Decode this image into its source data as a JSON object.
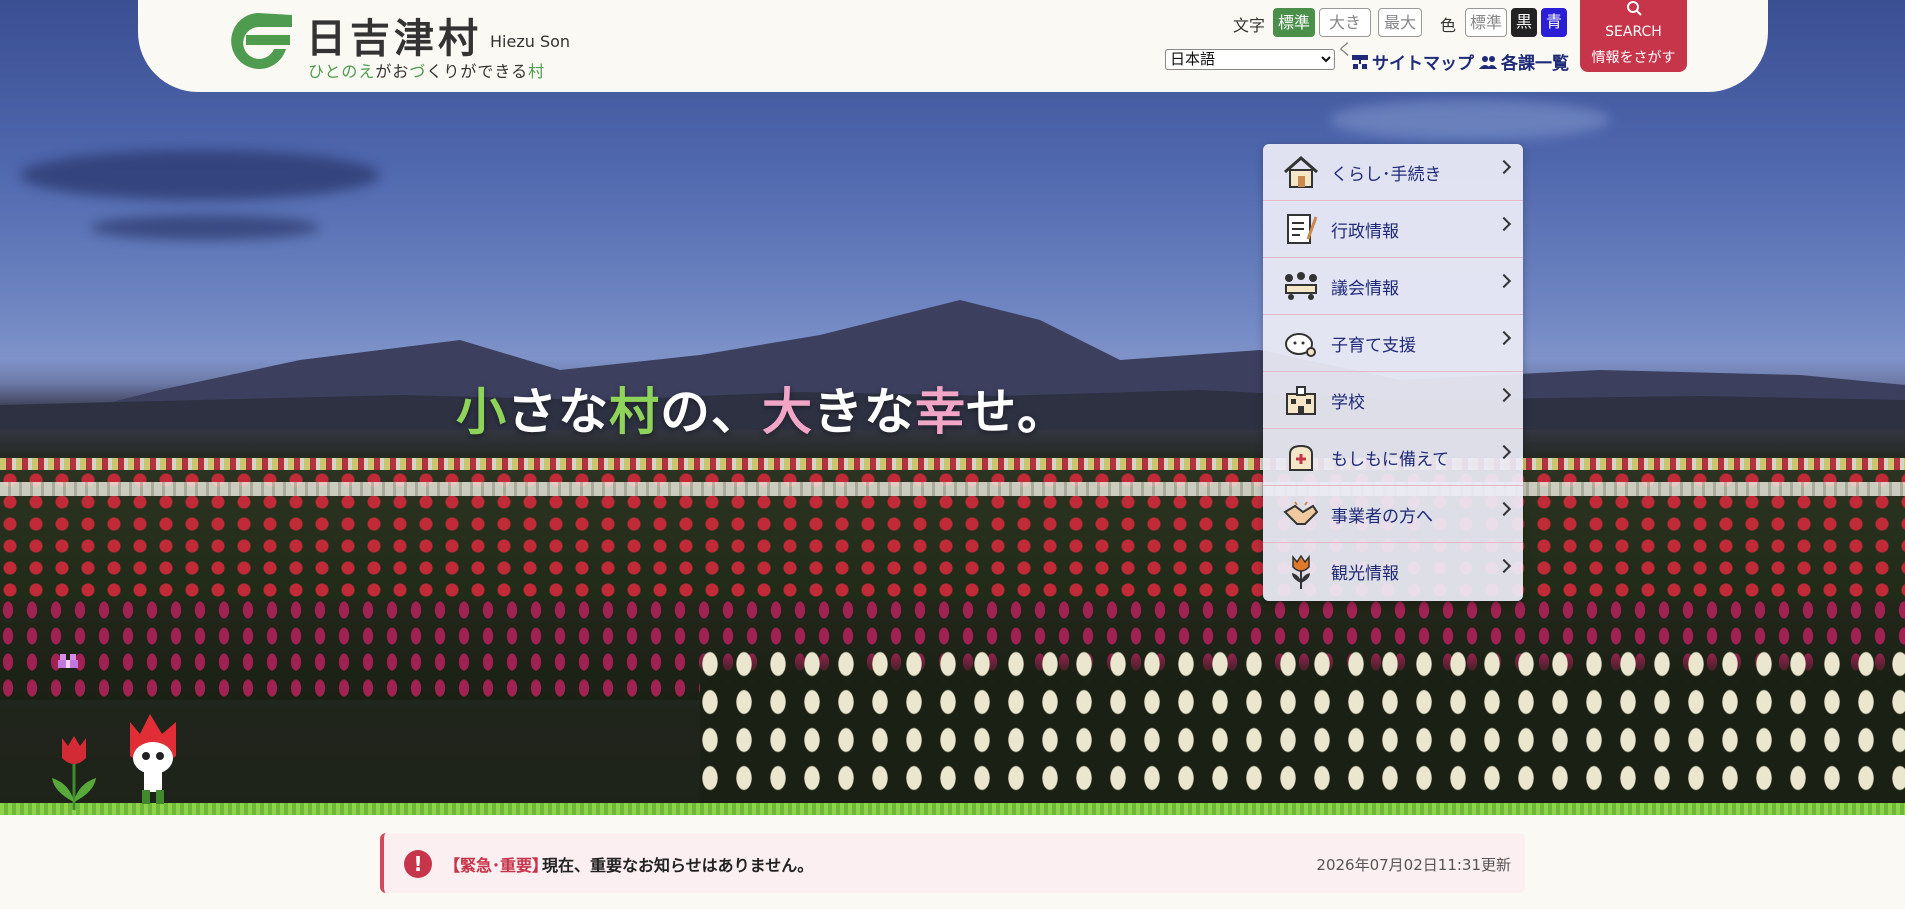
{
  "header": {
    "logo_name": "日吉津村",
    "logo_roman": "Hiezu Son",
    "logo_tagline": [
      "ひとの",
      "え",
      "がお",
      "づ",
      "くりができる",
      "村"
    ],
    "text_size": {
      "label": "文字",
      "options": [
        "標準",
        "大きく",
        "最大"
      ],
      "active": "標準"
    },
    "color": {
      "label": "色",
      "options": [
        "標準",
        "黒",
        "青"
      ]
    },
    "language_select": {
      "value": "日本語"
    },
    "sitemap_label": "サイトマップ",
    "departments_label": "各課一覧",
    "search": {
      "line1": "SEARCH",
      "line2": "情報をさがす"
    },
    "colors": {
      "accent_green": "#4a8f4a",
      "accent_red": "#c7354a",
      "link_navy": "#1f2a78"
    }
  },
  "hero": {
    "catchphrase": [
      "小",
      "さな",
      "村",
      "の、",
      "大",
      "きな",
      "幸",
      "せ。"
    ]
  },
  "menu": {
    "items": [
      {
        "label": "くらし･手続き",
        "icon": "house-icon"
      },
      {
        "label": "行政情報",
        "icon": "document-pen-icon"
      },
      {
        "label": "議会情報",
        "icon": "council-meeting-icon"
      },
      {
        "label": "子育て支援",
        "icon": "baby-icon"
      },
      {
        "label": "学校",
        "icon": "school-icon"
      },
      {
        "label": "もしもに備えて",
        "icon": "emergency-bag-icon"
      },
      {
        "label": "事業者の方へ",
        "icon": "handshake-icon"
      },
      {
        "label": "観光情報",
        "icon": "tulip-icon"
      }
    ]
  },
  "notice": {
    "tag": "【緊急･重要】",
    "text": "現在、重要なお知らせはありません。",
    "updated": "2026年07月02日11:31更新"
  }
}
